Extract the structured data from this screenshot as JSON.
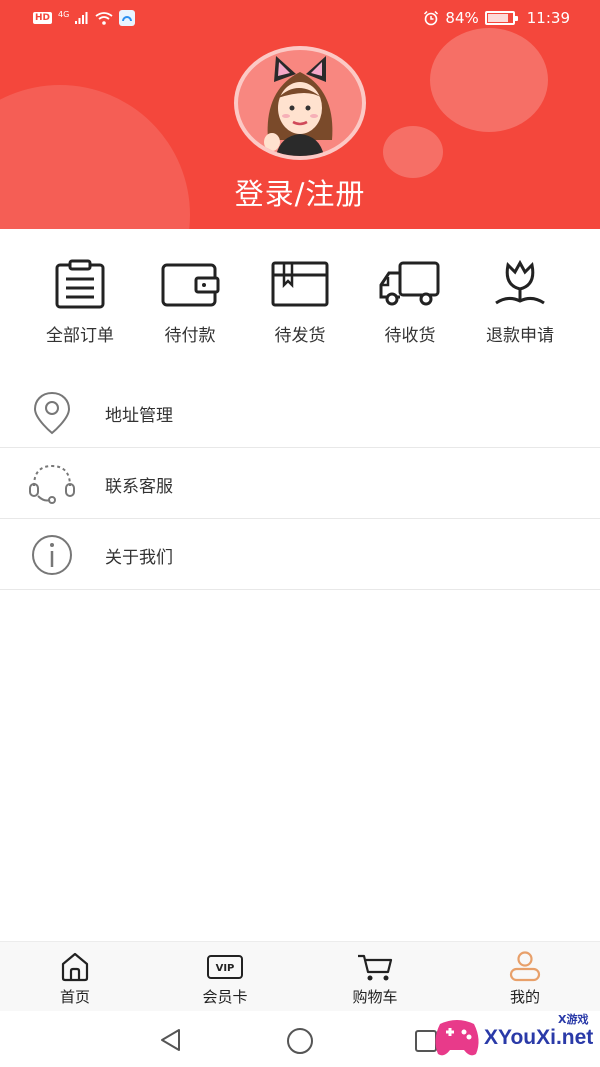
{
  "status_bar": {
    "hd": "HD",
    "network": "4G",
    "battery": "84%",
    "time": "11:39"
  },
  "header": {
    "login_label": "登录/注册"
  },
  "orders": [
    {
      "label": "全部订单",
      "icon": "clipboard-icon"
    },
    {
      "label": "待付款",
      "icon": "wallet-icon"
    },
    {
      "label": "待发货",
      "icon": "box-icon"
    },
    {
      "label": "待收货",
      "icon": "truck-icon"
    },
    {
      "label": "退款申请",
      "icon": "tulip-icon"
    }
  ],
  "menu": [
    {
      "label": "地址管理",
      "icon": "location-pin-icon"
    },
    {
      "label": "联系客服",
      "icon": "headset-icon"
    },
    {
      "label": "关于我们",
      "icon": "info-icon"
    }
  ],
  "bottom_nav": [
    {
      "label": "首页",
      "icon": "home-icon",
      "active": false
    },
    {
      "label": "会员卡",
      "icon": "vip-card-icon",
      "active": false
    },
    {
      "label": "购物车",
      "icon": "cart-icon",
      "active": false
    },
    {
      "label": "我的",
      "icon": "profile-icon",
      "active": true
    }
  ],
  "vip_icon_text": "VIP",
  "watermark": {
    "text": "XYouXi.net",
    "small": "X游戏"
  },
  "colors": {
    "brand_red": "#f4473c",
    "active_tab": "#e8a06a"
  }
}
